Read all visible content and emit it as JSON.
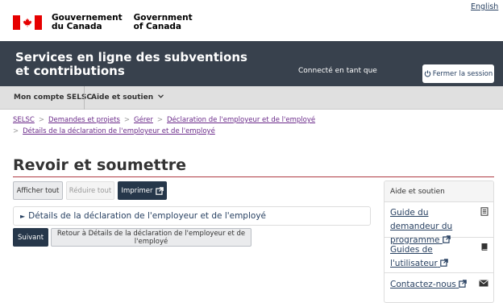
{
  "lang_toggle": "English",
  "signature": {
    "fr": [
      "Gouvernement",
      "du Canada"
    ],
    "en": [
      "Government",
      "of Canada"
    ]
  },
  "banner": {
    "title": "Services en ligne des subventions et contributions",
    "connected_text": "Connecté en tant que",
    "logout_label": "Fermer la session"
  },
  "menu": {
    "account": "Mon compte SELSC",
    "help": "Aide et soutien"
  },
  "breadcrumbs": [
    "SELSC",
    "Demandes et projets",
    "Gérer",
    "Déclaration de l'employeur et de l'employé",
    "Détails de la déclaration de l'employeur et de l'employé"
  ],
  "page_title": "Revoir et soumettre",
  "toolbar": {
    "expand_all": "Afficher tout",
    "collapse_all": "Réduire tout",
    "print": "Imprimer"
  },
  "details_summary": "Détails de la déclaration de l'employeur et de l'employé",
  "actions": {
    "next": "Suivant",
    "back": "Retour à Détails de la déclaration de l'employeur et de l'employé"
  },
  "side_panel": {
    "heading": "Aide et soutien",
    "links": [
      {
        "label": "Guide du demandeur du programme",
        "icon": "document-icon"
      },
      {
        "label": "Guides de l'utilisateur",
        "icon": "book-icon"
      },
      {
        "label": "Contactez-nous",
        "icon": "envelope-icon"
      }
    ]
  },
  "colors": {
    "banner": "#38414d",
    "primary": "#26374a",
    "link": "#284162",
    "rule": "#af3c43",
    "flag_red": "#e60000"
  }
}
